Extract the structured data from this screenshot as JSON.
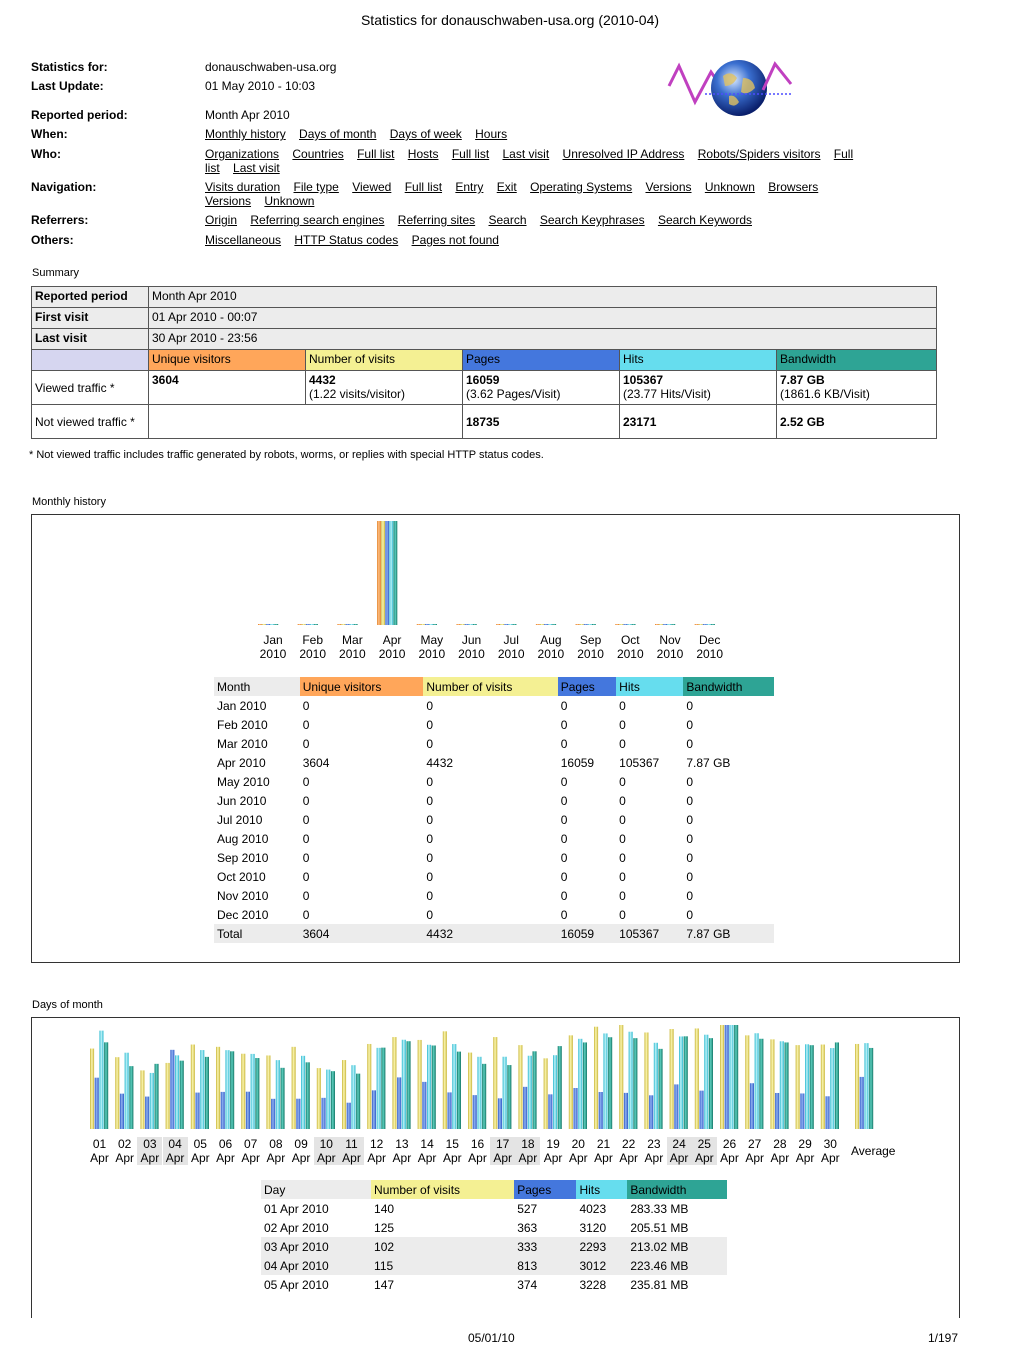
{
  "page_title": "Statistics for donauschwaben-usa.org (2010-04)",
  "header": {
    "stats_for_label": "Statistics for:",
    "stats_for_value": "donauschwaben-usa.org",
    "last_update_label": "Last Update:",
    "last_update_value": "01 May 2010 - 10:03",
    "reported_label": "Reported period:",
    "reported_value": "Month Apr 2010",
    "when_label": "When:",
    "when_links": [
      "Monthly history",
      "Days of month",
      "Days of week",
      "Hours"
    ],
    "who_label": "Who:",
    "who_links": [
      "Organizations",
      "Countries",
      "Full list",
      "Hosts",
      "Full list",
      "Last visit",
      "Unresolved IP Address",
      "Robots/Spiders visitors",
      "Full list",
      "Last visit"
    ],
    "nav_label": "Navigation:",
    "nav_links": [
      "Visits duration",
      "File type",
      "Viewed",
      "Full list",
      "Entry",
      "Exit",
      "Operating Systems",
      "Versions",
      "Unknown",
      "Browsers",
      "Versions",
      "Unknown"
    ],
    "ref_label": "Referrers:",
    "ref_links": [
      "Origin",
      "Referring search engines",
      "Referring sites",
      "Search",
      "Search Keyphrases",
      "Search Keywords"
    ],
    "others_label": "Others:",
    "others_links": [
      "Miscellaneous",
      "HTTP Status codes",
      "Pages not found"
    ]
  },
  "summary": {
    "section_title": "Summary",
    "reported_period_label": "Reported period",
    "reported_period_value": "Month Apr 2010",
    "first_visit_label": "First visit",
    "first_visit_value": "01 Apr 2010 - 00:07",
    "last_visit_label": "Last visit",
    "last_visit_value": "30 Apr 2010 - 23:56",
    "col_unique": "Unique visitors",
    "col_visits": "Number of visits",
    "col_pages": "Pages",
    "col_hits": "Hits",
    "col_bandwidth": "Bandwidth",
    "viewed_label": "Viewed traffic *",
    "viewed_unique": "3604",
    "viewed_visits": "4432",
    "viewed_visits_sub": "(1.22 visits/visitor)",
    "viewed_pages": "16059",
    "viewed_pages_sub": "(3.62 Pages/Visit)",
    "viewed_hits": "105367",
    "viewed_hits_sub": "(23.77 Hits/Visit)",
    "viewed_bw": "7.87 GB",
    "viewed_bw_sub": "(1861.6 KB/Visit)",
    "not_viewed_label": "Not viewed traffic *",
    "not_viewed_pages": "18735",
    "not_viewed_hits": "23171",
    "not_viewed_bw": "2.52 GB",
    "footnote": "* Not viewed traffic includes traffic generated by robots, worms, or replies with special HTTP status codes."
  },
  "monthly": {
    "section_title": "Monthly history",
    "headers": [
      "Month",
      "Unique visitors",
      "Number of visits",
      "Pages",
      "Hits",
      "Bandwidth"
    ],
    "rows": [
      [
        "Jan 2010",
        "0",
        "0",
        "0",
        "0",
        "0"
      ],
      [
        "Feb 2010",
        "0",
        "0",
        "0",
        "0",
        "0"
      ],
      [
        "Mar 2010",
        "0",
        "0",
        "0",
        "0",
        "0"
      ],
      [
        "Apr 2010",
        "3604",
        "4432",
        "16059",
        "105367",
        "7.87 GB"
      ],
      [
        "May 2010",
        "0",
        "0",
        "0",
        "0",
        "0"
      ],
      [
        "Jun 2010",
        "0",
        "0",
        "0",
        "0",
        "0"
      ],
      [
        "Jul 2010",
        "0",
        "0",
        "0",
        "0",
        "0"
      ],
      [
        "Aug 2010",
        "0",
        "0",
        "0",
        "0",
        "0"
      ],
      [
        "Sep 2010",
        "0",
        "0",
        "0",
        "0",
        "0"
      ],
      [
        "Oct 2010",
        "0",
        "0",
        "0",
        "0",
        "0"
      ],
      [
        "Nov 2010",
        "0",
        "0",
        "0",
        "0",
        "0"
      ],
      [
        "Dec 2010",
        "0",
        "0",
        "0",
        "0",
        "0"
      ]
    ],
    "total": [
      "Total",
      "3604",
      "4432",
      "16059",
      "105367",
      "7.87 GB"
    ]
  },
  "days": {
    "section_title": "Days of month",
    "average_label": "Average",
    "headers": [
      "Day",
      "Number of visits",
      "Pages",
      "Hits",
      "Bandwidth"
    ],
    "rows": [
      [
        "01 Apr 2010",
        "140",
        "527",
        "4023",
        "283.33 MB"
      ],
      [
        "02 Apr 2010",
        "125",
        "363",
        "3120",
        "205.51 MB"
      ],
      [
        "03 Apr 2010",
        "102",
        "333",
        "2293",
        "213.02 MB"
      ],
      [
        "04 Apr 2010",
        "115",
        "813",
        "3012",
        "223.46 MB"
      ],
      [
        "05 Apr 2010",
        "147",
        "374",
        "3228",
        "235.81 MB"
      ]
    ]
  },
  "chart_data": [
    {
      "type": "bar",
      "categories": [
        "Jan 2010",
        "Feb 2010",
        "Mar 2010",
        "Apr 2010",
        "May 2010",
        "Jun 2010",
        "Jul 2010",
        "Aug 2010",
        "Sep 2010",
        "Oct 2010",
        "Nov 2010",
        "Dec 2010"
      ],
      "series": [
        {
          "name": "Unique visitors",
          "values": [
            0,
            0,
            0,
            3604,
            0,
            0,
            0,
            0,
            0,
            0,
            0,
            0
          ]
        },
        {
          "name": "Number of visits",
          "values": [
            0,
            0,
            0,
            4432,
            0,
            0,
            0,
            0,
            0,
            0,
            0,
            0
          ]
        },
        {
          "name": "Pages",
          "values": [
            0,
            0,
            0,
            16059,
            0,
            0,
            0,
            0,
            0,
            0,
            0,
            0
          ]
        },
        {
          "name": "Hits",
          "values": [
            0,
            0,
            0,
            105367,
            0,
            0,
            0,
            0,
            0,
            0,
            0,
            0
          ]
        },
        {
          "name": "Bandwidth",
          "values": [
            0,
            0,
            0,
            7.87,
            0,
            0,
            0,
            0,
            0,
            0,
            0,
            0
          ]
        }
      ]
    },
    {
      "type": "bar",
      "categories": [
        "01",
        "02",
        "03",
        "04",
        "05",
        "06",
        "07",
        "08",
        "09",
        "10",
        "11",
        "12",
        "13",
        "14",
        "15",
        "16",
        "17",
        "18",
        "19",
        "20",
        "21",
        "22",
        "23",
        "24",
        "25",
        "26",
        "27",
        "28",
        "29",
        "30",
        "Average"
      ],
      "weekend": [
        "03",
        "04",
        "10",
        "11",
        "17",
        "18",
        "24",
        "25"
      ],
      "series": [
        {
          "name": "Number of visits",
          "values": [
            140,
            125,
            102,
            115,
            147,
            143,
            131,
            128,
            143,
            106,
            120,
            148,
            160,
            155,
            170,
            133,
            160,
            146,
            123,
            163,
            178,
            181,
            168,
            174,
            175,
            181,
            163,
            156,
            146,
            147,
            148
          ]
        },
        {
          "name": "Pages",
          "values": [
            527,
            363,
            333,
            813,
            374,
            381,
            383,
            310,
            311,
            320,
            270,
            397,
            530,
            484,
            376,
            348,
            315,
            433,
            356,
            421,
            380,
            371,
            346,
            458,
            394,
            1068,
            470,
            370,
            365,
            336,
            535
          ]
        },
        {
          "name": "Hits",
          "values": [
            4023,
            3120,
            2293,
            3012,
            3228,
            3224,
            3071,
            2816,
            2992,
            2430,
            2610,
            3319,
            3650,
            3444,
            3474,
            2953,
            2955,
            2996,
            3018,
            3688,
            3908,
            3978,
            3526,
            3785,
            3856,
            4253,
            3916,
            3587,
            3465,
            3310,
            3512
          ]
        },
        {
          "name": "Bandwidth",
          "values": [
            283.33,
            205.51,
            213.02,
            223.46,
            235.81,
            254,
            232,
            200,
            218,
            189,
            181,
            266,
            287,
            273,
            253,
            213,
            209,
            254,
            271,
            283,
            300,
            297,
            262,
            303,
            297,
            340,
            295,
            283,
            274,
            283,
            265
          ]
        }
      ]
    }
  ],
  "footer": {
    "date": "05/01/10",
    "page": "1/197"
  }
}
